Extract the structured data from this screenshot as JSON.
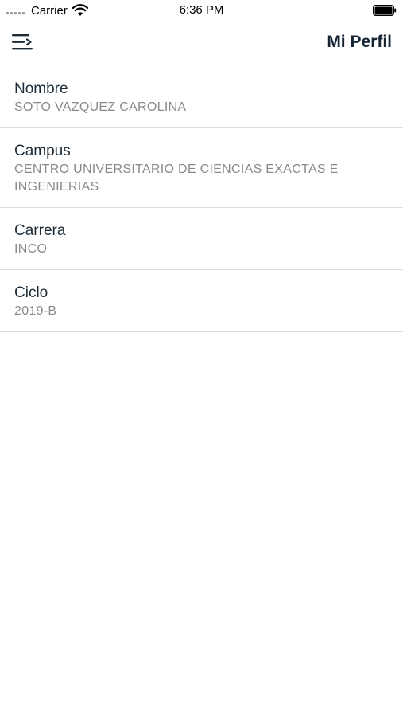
{
  "status_bar": {
    "carrier": "Carrier",
    "time": "6:36 PM"
  },
  "nav": {
    "title": "Mi Perfil",
    "menu_icon": "menu-lines-icon"
  },
  "profile": {
    "rows": [
      {
        "label": "Nombre",
        "value": "SOTO VAZQUEZ CAROLINA"
      },
      {
        "label": "Campus",
        "value": "CENTRO UNIVERSITARIO DE CIENCIAS EXACTAS E INGENIERIAS"
      },
      {
        "label": "Carrera",
        "value": "INCO"
      },
      {
        "label": "Ciclo",
        "value": "2019-B"
      }
    ]
  },
  "colors": {
    "title": "#152533",
    "label": "#1c2b36",
    "value": "#8a8a8a",
    "divider": "#dedede"
  }
}
